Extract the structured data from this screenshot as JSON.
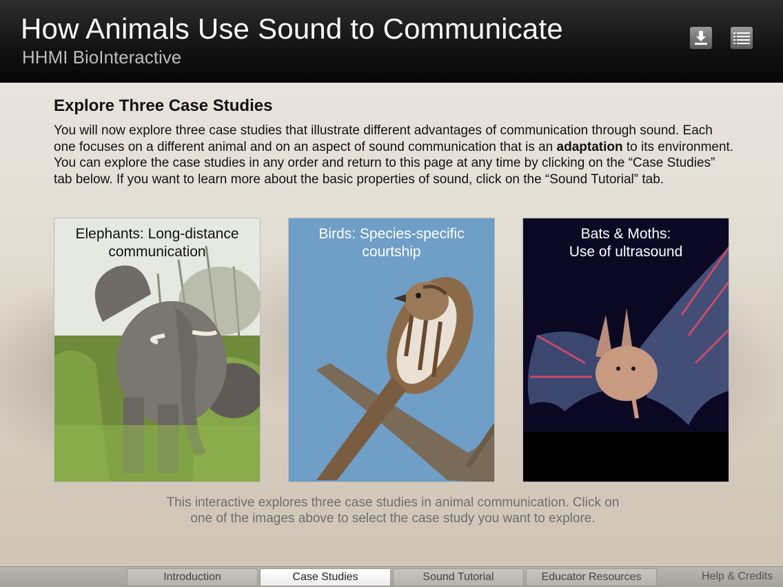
{
  "header": {
    "title": "How Animals Use Sound to Communicate",
    "subtitle": "HHMI BioInteractive",
    "download_icon": "download-icon",
    "menu_icon": "list-menu-icon"
  },
  "main": {
    "heading": "Explore Three Case Studies",
    "intro_part1": "You will now explore three case studies that illustrate different advantages of communication through sound. Each one focuses on a different animal and on an aspect of sound communication that is an ",
    "intro_bold": "adaptation",
    "intro_part2": " to its environment. You can explore the case studies in any order and return to this page at any time by clicking on the “Case Studies” tab below. If you want to learn more about the basic properties of sound, click on the “Sound Tutorial” tab.",
    "cards": [
      {
        "line1": "Elephants: Long-distance",
        "line2": "communication"
      },
      {
        "line1": "Birds: Species-specific",
        "line2": "courtship"
      },
      {
        "line1": "Bats & Moths:",
        "line2": "Use of ultrasound"
      }
    ],
    "note": "This interactive explores three case studies in animal communication. Click on one of the images above to select the case study you want to explore."
  },
  "tabs": {
    "items": [
      "Introduction",
      "Case Studies",
      "Sound Tutorial",
      "Educator Resources"
    ],
    "active": "Case Studies",
    "help": "Help & Credits"
  }
}
